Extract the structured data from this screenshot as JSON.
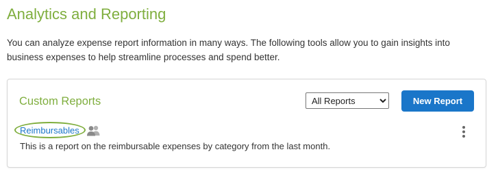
{
  "page": {
    "title": "Analytics and Reporting",
    "intro": "You can analyze expense report information in many ways. The following tools allow you to gain insights into business expenses to help streamline processes and spend better."
  },
  "custom_reports": {
    "title": "Custom Reports",
    "filter": {
      "selected": "All Reports",
      "options": [
        "All Reports"
      ]
    },
    "new_report_label": "New Report",
    "reports": [
      {
        "name": "Reimbursables",
        "description": "This is a report on the reimbursable expenses by category from the last month.",
        "shared_icon": "people-icon",
        "menu_icon": "kebab-menu-icon"
      }
    ]
  },
  "colors": {
    "accent_green": "#7fae3e",
    "primary_blue": "#1a76c9",
    "text": "#333333",
    "icon_gray": "#8a8a8a"
  }
}
